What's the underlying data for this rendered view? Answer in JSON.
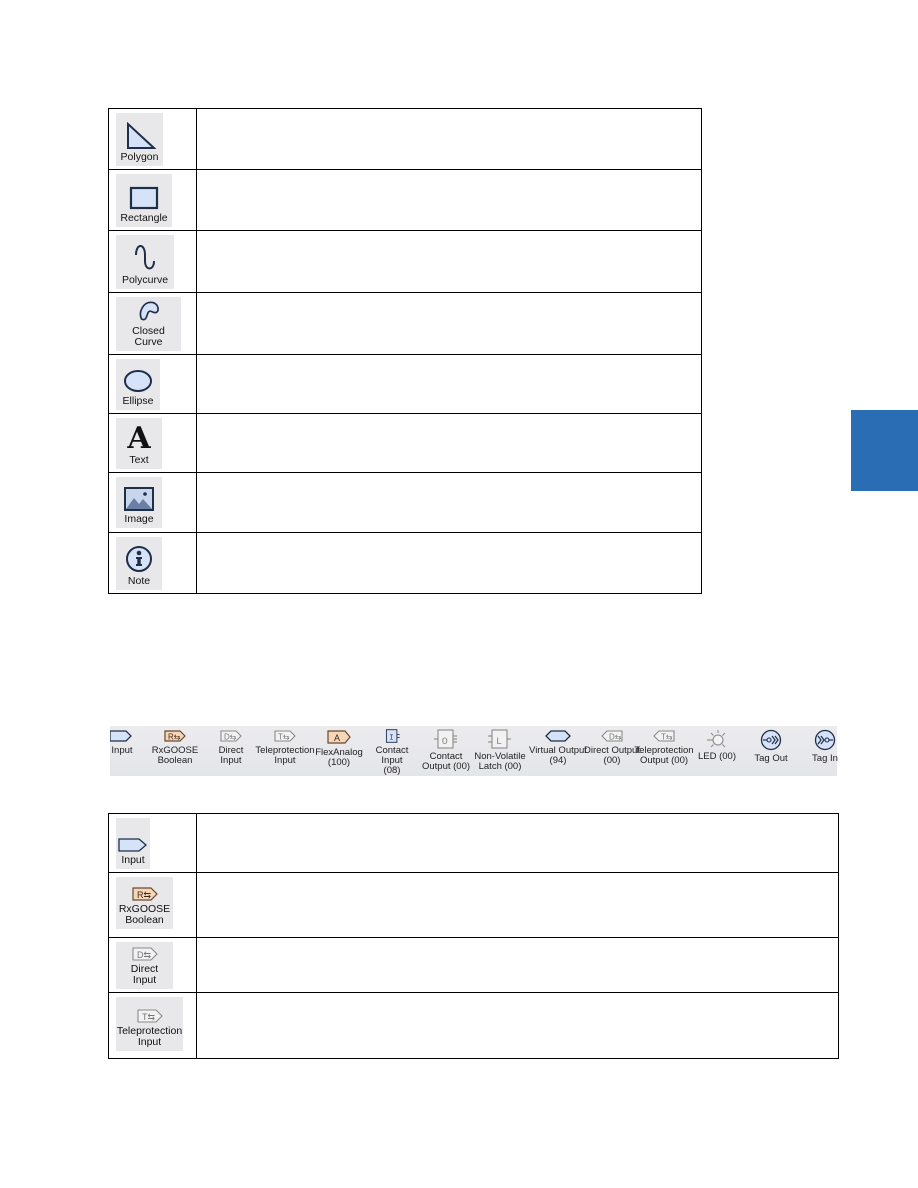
{
  "drawing_tools_table": {
    "rows": [
      {
        "icon": "polygon-icon",
        "label": "Polygon",
        "description": ""
      },
      {
        "icon": "rectangle-icon",
        "label": "Rectangle",
        "description": ""
      },
      {
        "icon": "polycurve-icon",
        "label": "Polycurve",
        "description": ""
      },
      {
        "icon": "closed-curve-icon",
        "label": "Closed Curve",
        "description": ""
      },
      {
        "icon": "ellipse-icon",
        "label": "Ellipse",
        "description": ""
      },
      {
        "icon": "text-icon",
        "label": "Text",
        "glyph": "A",
        "description": ""
      },
      {
        "icon": "image-icon",
        "label": "Image",
        "description": ""
      },
      {
        "icon": "note-icon",
        "label": "Note",
        "description": ""
      }
    ]
  },
  "toolbar_strip": {
    "items": [
      {
        "icon": "input-icon",
        "label_line1": "Input",
        "label_line2": ""
      },
      {
        "icon": "rxgoose-boolean-icon",
        "glyph": "R",
        "label_line1": "RxGOOSE",
        "label_line2": "Boolean"
      },
      {
        "icon": "direct-input-icon",
        "glyph": "D",
        "label_line1": "Direct Input",
        "label_line2": ""
      },
      {
        "icon": "teleprotection-input-icon",
        "glyph": "T",
        "label_line1": "Teleprotection",
        "label_line2": "Input"
      },
      {
        "icon": "flexanalog-icon",
        "glyph": "A",
        "label_line1": "FlexAnalog",
        "label_line2": "(100)"
      },
      {
        "icon": "contact-input-icon",
        "glyph": "I",
        "label_line1": "Contact Input",
        "label_line2": "(08)"
      },
      {
        "icon": "contact-output-icon",
        "glyph": "O",
        "label_line1": "Contact",
        "label_line2": "Output (00)"
      },
      {
        "icon": "non-volatile-latch-icon",
        "glyph": "L",
        "label_line1": "Non-Volatile",
        "label_line2": "Latch (00)"
      },
      {
        "icon": "virtual-output-icon",
        "label_line1": "Virtual Output",
        "label_line2": "(94)"
      },
      {
        "icon": "direct-output-icon",
        "glyph": "D",
        "label_line1": "Direct Output",
        "label_line2": "(00)"
      },
      {
        "icon": "teleprotection-output-icon",
        "glyph": "T",
        "label_line1": "Teleprotection",
        "label_line2": "Output (00)"
      },
      {
        "icon": "led-icon",
        "label_line1": "LED (00)",
        "label_line2": ""
      },
      {
        "icon": "tag-out-icon",
        "label_line1": "Tag Out",
        "label_line2": ""
      },
      {
        "icon": "tag-in-icon",
        "label_line1": "Tag In",
        "label_line2": ""
      }
    ]
  },
  "input_elements_table": {
    "rows": [
      {
        "icon": "input-icon",
        "label_line1": "Input",
        "label_line2": "",
        "description": ""
      },
      {
        "icon": "rxgoose-boolean-icon",
        "glyph": "R",
        "label_line1": "RxGOOSE",
        "label_line2": "Boolean",
        "description": ""
      },
      {
        "icon": "direct-input-icon",
        "glyph": "D",
        "label_line1": "Direct Input",
        "label_line2": "",
        "description": ""
      },
      {
        "icon": "teleprotection-input-icon",
        "glyph": "T",
        "label_line1": "Teleprotection",
        "label_line2": "Input",
        "description": ""
      }
    ]
  },
  "colors": {
    "chapter_tab": "#2a6db5",
    "icon_fill": "#d6e2f7",
    "icon_stroke": "#1f2f4a",
    "rxgoose_fill": "#f6d6b8",
    "button_bg": "#e8e8ea"
  }
}
